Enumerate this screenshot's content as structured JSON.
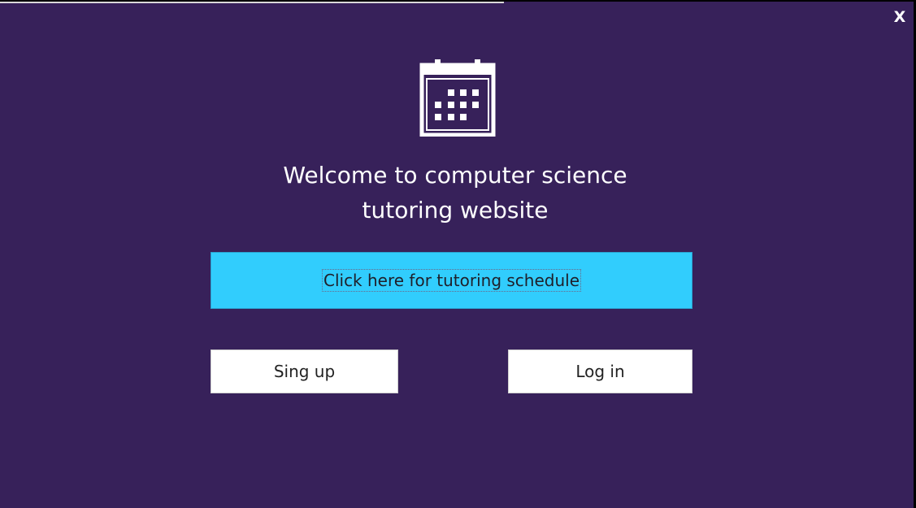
{
  "window": {
    "close_label": "X"
  },
  "welcome": {
    "line1": "Welcome to computer science",
    "line2": "tutoring website"
  },
  "schedule_button": {
    "label": "Click here for tutoring schedule"
  },
  "signup_button": {
    "label": "Sing up"
  },
  "login_button": {
    "label": "Log in"
  },
  "icons": {
    "hero": "calendar-icon"
  },
  "colors": {
    "background": "#37215a",
    "accent_button": "#31cdfd",
    "text_on_dark": "#ffffff"
  }
}
